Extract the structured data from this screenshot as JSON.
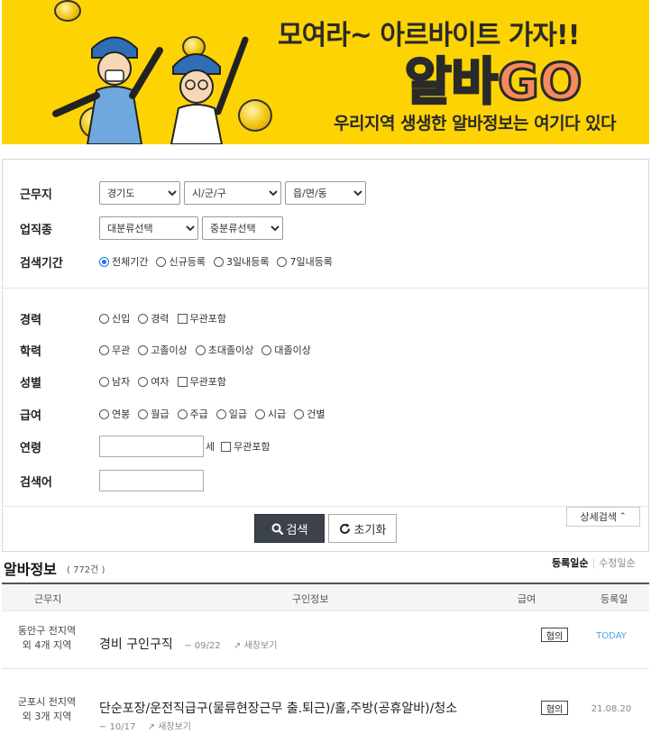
{
  "banner": {
    "tagline": "모여라~ 아르바이트 가자!!",
    "logo_part1": "알바",
    "logo_part2": "GO",
    "subtitle": "우리지역 생생한 알바정보는 여기다 있다"
  },
  "search": {
    "workplace": {
      "label": "근무지",
      "province": "경기도",
      "city": "시/군/구",
      "town": "읍/면/동"
    },
    "industry": {
      "label": "업직종",
      "major": "대분류선택",
      "minor": "중분류선택"
    },
    "period": {
      "label": "검색기간",
      "options": [
        "전체기간",
        "신규등록",
        "3일내등록",
        "7일내등록"
      ],
      "selected": "전체기간"
    },
    "career": {
      "label": "경력",
      "options": [
        "신입",
        "경력"
      ],
      "check": "무관포함"
    },
    "education": {
      "label": "학력",
      "options": [
        "무관",
        "고졸이상",
        "초대졸이상",
        "대졸이상"
      ]
    },
    "gender": {
      "label": "성별",
      "options": [
        "남자",
        "여자"
      ],
      "check": "무관포함"
    },
    "salary": {
      "label": "급여",
      "options": [
        "연봉",
        "월급",
        "주급",
        "일급",
        "시급",
        "건별"
      ]
    },
    "age": {
      "label": "연령",
      "unit": "세",
      "check": "무관포함",
      "value": ""
    },
    "keyword": {
      "label": "검색어",
      "value": ""
    },
    "search_btn": "검색",
    "reset_btn": "초기화",
    "detail_btn": "상세검색"
  },
  "results": {
    "title": "알바정보",
    "count": "( 772건 )",
    "sort_on": "등록일순",
    "sort_off": "수정일순",
    "columns": {
      "location": "근무지",
      "info": "구인정보",
      "pay": "급여",
      "date": "등록일"
    },
    "rows": [
      {
        "loc1": "동안구 전지역",
        "loc2": "외 4개 지역",
        "title": "경비 구인구직",
        "deadline": "~ 09/22",
        "newwin": "새창보기",
        "pay": "협의",
        "date": "TODAY"
      },
      {
        "loc1": "군포시 전지역",
        "loc2": "외 3개 지역",
        "title": "단순포장/운전직급구(물류현장근무 출.퇴근)/홀,주방(공휴알바)/청소",
        "deadline": "~ 10/17",
        "newwin": "새창보기",
        "pay": "협의",
        "date": "21.08.20"
      }
    ]
  },
  "colors": {
    "banner_bg": "#fed304",
    "search_btn": "#3b4249",
    "today": "#4aa3df"
  }
}
